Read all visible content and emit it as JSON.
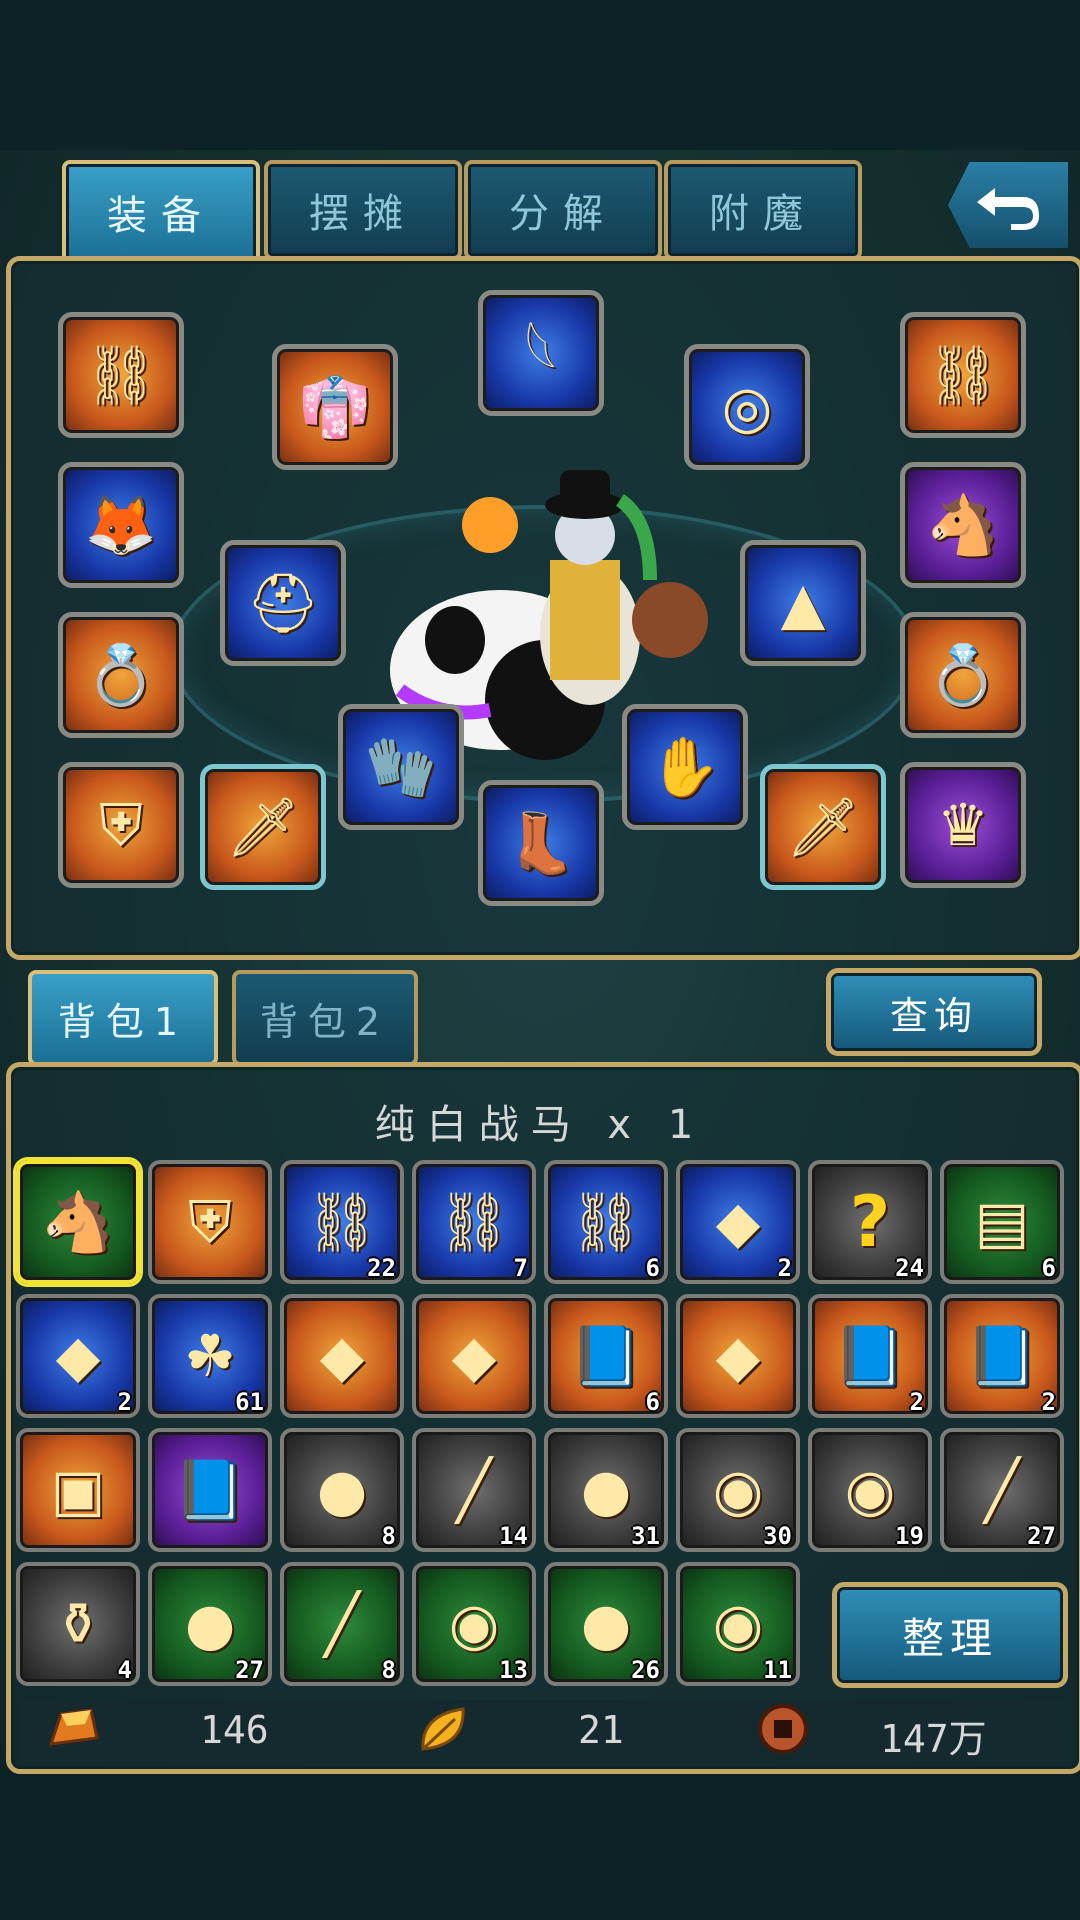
{
  "tabs": [
    "装备",
    "摆摊",
    "分解",
    "附魔"
  ],
  "bag_tabs": [
    "背包1",
    "背包2"
  ],
  "query_button": "查询",
  "sort_button": "整理",
  "selected_item": "纯白战马 x 1",
  "equipment_slots": [
    {
      "icon": "chain-icon",
      "quality": "orange"
    },
    {
      "icon": "robe-icon",
      "quality": "orange"
    },
    {
      "icon": "wings-icon",
      "quality": "blue"
    },
    {
      "icon": "bowl-icon",
      "quality": "blue"
    },
    {
      "icon": "chain-icon",
      "quality": "orange"
    },
    {
      "icon": "fox-pet-icon",
      "quality": "blue"
    },
    {
      "icon": "horse-icon",
      "quality": "purple"
    },
    {
      "icon": "helmet-icon",
      "quality": "blue"
    },
    {
      "icon": "skirt-icon",
      "quality": "blue"
    },
    {
      "icon": "ring-icon",
      "quality": "orange"
    },
    {
      "icon": "ring-icon",
      "quality": "orange"
    },
    {
      "icon": "shoulder-armor-icon",
      "quality": "orange"
    },
    {
      "icon": "dagger-icon",
      "quality": "orange"
    },
    {
      "icon": "glove-icon",
      "quality": "blue"
    },
    {
      "icon": "boot-icon",
      "quality": "blue"
    },
    {
      "icon": "bracer-icon",
      "quality": "blue"
    },
    {
      "icon": "dagger-icon",
      "quality": "orange"
    },
    {
      "icon": "vip-crown-icon",
      "quality": "purple"
    }
  ],
  "inventory": [
    {
      "icon": "horse-icon",
      "quality": "green",
      "count": "",
      "selected": true
    },
    {
      "icon": "shoulder-armor-icon",
      "quality": "orange",
      "count": ""
    },
    {
      "icon": "chain-icon",
      "quality": "blue",
      "count": "22"
    },
    {
      "icon": "chain-icon",
      "quality": "blue",
      "count": "7"
    },
    {
      "icon": "chain-icon",
      "quality": "blue",
      "count": "6"
    },
    {
      "icon": "red-gem-icon",
      "quality": "blue",
      "count": "2"
    },
    {
      "icon": "mystery-icon",
      "quality": "gray",
      "count": "24"
    },
    {
      "icon": "scroll-card-icon",
      "quality": "green",
      "count": "6"
    },
    {
      "icon": "red-gem-icon",
      "quality": "blue",
      "count": "2"
    },
    {
      "icon": "herb-icon",
      "quality": "blue",
      "count": "61"
    },
    {
      "icon": "red-gem-icon",
      "quality": "orange",
      "count": ""
    },
    {
      "icon": "red-gem-icon",
      "quality": "orange",
      "count": ""
    },
    {
      "icon": "book-icon",
      "quality": "orange",
      "count": "6"
    },
    {
      "icon": "red-gem-icon",
      "quality": "orange",
      "count": ""
    },
    {
      "icon": "book-icon",
      "quality": "orange",
      "count": "2"
    },
    {
      "icon": "book-icon",
      "quality": "orange",
      "count": "2"
    },
    {
      "icon": "treasure-chest-icon",
      "quality": "orange",
      "count": ""
    },
    {
      "icon": "book-icon",
      "quality": "purple",
      "count": ""
    },
    {
      "icon": "ore-icon",
      "quality": "gray",
      "count": "8"
    },
    {
      "icon": "wood-log-icon",
      "quality": "gray",
      "count": "14"
    },
    {
      "icon": "ore-icon",
      "quality": "gray",
      "count": "31"
    },
    {
      "icon": "blue-ore-icon",
      "quality": "gray",
      "count": "30"
    },
    {
      "icon": "blue-ore-icon",
      "quality": "gray",
      "count": "19"
    },
    {
      "icon": "wood-log-icon",
      "quality": "gray",
      "count": "27"
    },
    {
      "icon": "pouch-icon",
      "quality": "gray",
      "count": "4"
    },
    {
      "icon": "ore-icon",
      "quality": "green",
      "count": "27"
    },
    {
      "icon": "wood-log-icon",
      "quality": "green",
      "count": "8"
    },
    {
      "icon": "blue-ore-icon",
      "quality": "green",
      "count": "13"
    },
    {
      "icon": "ore-icon",
      "quality": "green",
      "count": "26"
    },
    {
      "icon": "blue-ore-icon",
      "quality": "green",
      "count": "11"
    }
  ],
  "currency": {
    "gold": "146",
    "leaf": "21",
    "coin": "147万"
  },
  "colors": {
    "frame": "#c6a866",
    "tab_active": "#3aa0c8",
    "selected": "#f2e436"
  }
}
